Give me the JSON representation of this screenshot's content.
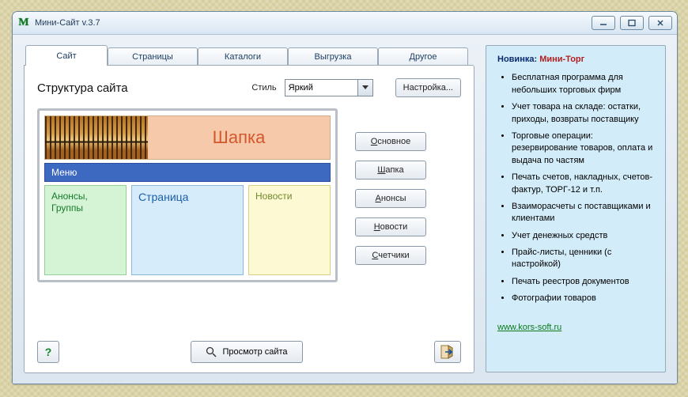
{
  "window": {
    "title": "Мини-Сайт v.3.7",
    "icon_letter": "M"
  },
  "tabs": [
    "Сайт",
    "Страницы",
    "Каталоги",
    "Выгрузка",
    "Другое"
  ],
  "active_tab": 0,
  "panel": {
    "heading": "Структура сайта",
    "style_label": "Стиль",
    "style_value": "Яркий",
    "settings_btn": "Настройка..."
  },
  "preview": {
    "header_label": "Шапка",
    "menu_label": "Меню",
    "anons_label": "Анонсы,\nГруппы",
    "page_label": "Страница",
    "news_label": "Новости"
  },
  "side_buttons": {
    "main": {
      "pre": "",
      "u": "О",
      "post": "сновное"
    },
    "header": {
      "pre": "",
      "u": "Ш",
      "post": "апка"
    },
    "anons": {
      "pre": "",
      "u": "А",
      "post": "нонсы"
    },
    "news": {
      "pre": "",
      "u": "Н",
      "post": "овости"
    },
    "count": {
      "pre": "",
      "u": "С",
      "post": "четчики"
    }
  },
  "bottom": {
    "help": "?",
    "preview_site": "Просмотр сайта"
  },
  "promo": {
    "title_lead": "Новинка: ",
    "title_red": "Мини-Торг",
    "items": [
      "Бесплатная программа для небольших торговых фирм",
      "Учет товара на складе: остатки, приходы, возвраты поставщику",
      "Торговые операции: резервирование товаров, оплата и выдача по частям",
      "Печать счетов, накладных, счетов-фактур, ТОРГ-12 и т.п.",
      "Взаиморасчеты с поставщиками и клиентами",
      "Учет денежных средств",
      "Прайс-листы, ценники (с настройкой)",
      "Печать реестров документов",
      "Фотографии товаров"
    ],
    "link": "www.kors-soft.ru"
  }
}
